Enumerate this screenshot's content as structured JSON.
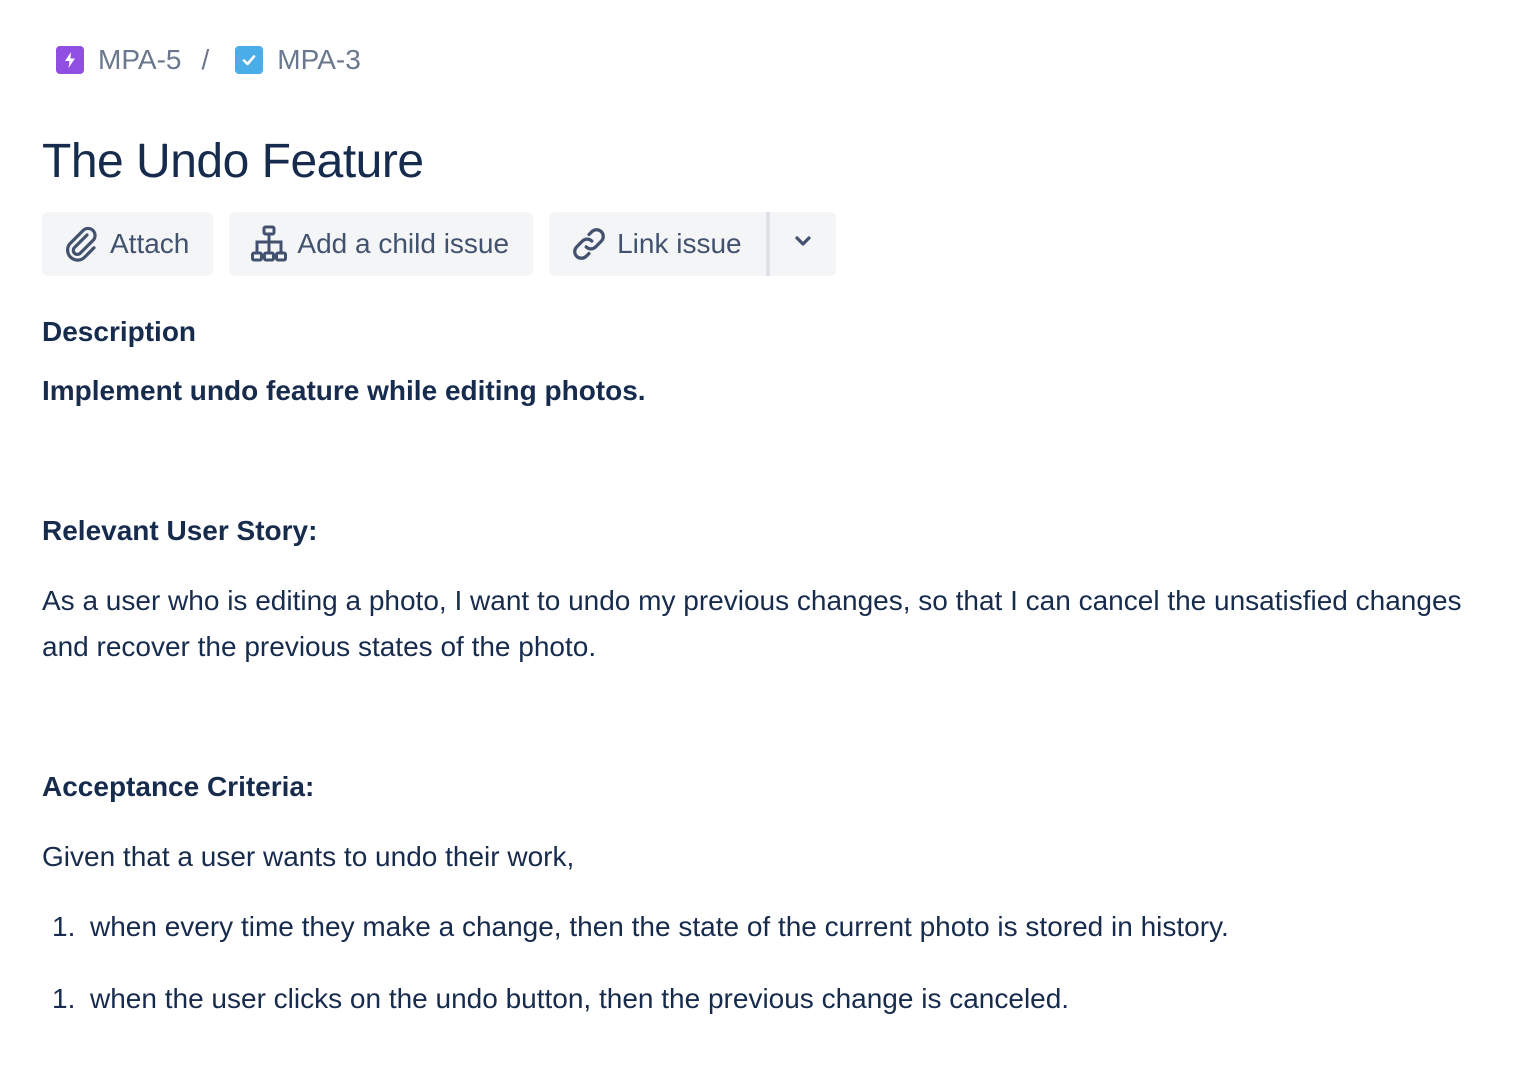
{
  "breadcrumb": {
    "items": [
      {
        "label": "MPA-5",
        "icon": "epic-lightning-icon",
        "color": "#904ee2"
      },
      {
        "label": "MPA-3",
        "icon": "task-checkbox-icon",
        "color": "#4bade8"
      }
    ],
    "separator": "/"
  },
  "issue": {
    "title": "The Undo Feature"
  },
  "toolbar": {
    "attach_label": "Attach",
    "add_child_label": "Add a child issue",
    "link_issue_label": "Link issue"
  },
  "description": {
    "label": "Description",
    "summary": "Implement undo feature while editing photos.",
    "story_heading": "Relevant User Story:",
    "story_text": "As a user who is editing a photo, I want to undo my previous changes, so that I can cancel the unsatisfied changes and recover the previous states of the photo.",
    "criteria_heading": "Acceptance Criteria:",
    "criteria_intro": "Given that a user wants to undo their work,",
    "criteria": [
      {
        "number": "1.",
        "text": "when every time they make a change, then the state of the current photo is stored in history."
      },
      {
        "number": "1.",
        "text": "when the user clicks on the undo button, then the previous change is canceled."
      }
    ]
  },
  "colors": {
    "text": "#172b4d",
    "muted": "#6b778c",
    "button_bg": "#f4f5f7",
    "button_text": "#42526e"
  }
}
